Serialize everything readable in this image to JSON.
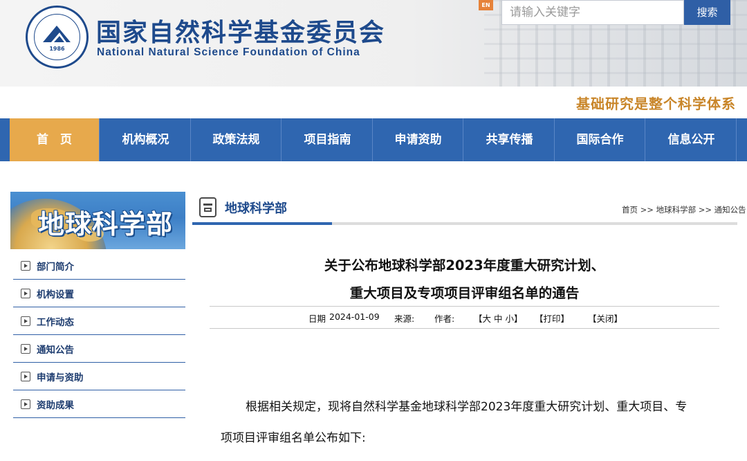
{
  "header": {
    "site_title_cn": "国家自然科学基金委员会",
    "site_title_en": "National Natural Science Foundation of China",
    "logo_year": "1986",
    "lang_switch": "EN",
    "search": {
      "placeholder": "请输入关键字",
      "button_label": "搜索"
    }
  },
  "slogan": "基础研究是整个科学体系",
  "nav": {
    "items": [
      {
        "label": "首　页",
        "active": true
      },
      {
        "label": "机构概况"
      },
      {
        "label": "政策法规"
      },
      {
        "label": "项目指南"
      },
      {
        "label": "申请资助"
      },
      {
        "label": "共享传播"
      },
      {
        "label": "国际合作"
      },
      {
        "label": "信息公开"
      }
    ]
  },
  "sidebar": {
    "banner_title": "地球科学部",
    "items": [
      {
        "label": "部门简介"
      },
      {
        "label": "机构设置"
      },
      {
        "label": "工作动态"
      },
      {
        "label": "通知公告"
      },
      {
        "label": "申请与资助"
      },
      {
        "label": "资助成果"
      }
    ]
  },
  "main": {
    "section_title": "地球科学部",
    "breadcrumb": "首页 >> 地球科学部 >> 通知公告",
    "article": {
      "title_line1": "关于公布地球科学部2023年度重大研究计划、",
      "title_line2": "重大项目及专项项目评审组名单的通告",
      "meta": {
        "date_label": "日期",
        "date": "2024-01-09",
        "source_label": "来源:",
        "author_label": "作者:",
        "font_size_control": "【大 中 小】",
        "print_label": "【打印】",
        "close_label": "【关闭】"
      },
      "body_line1": "根据相关规定，现将自然科学基金地球科学部2023年度重大研究计划、重大项目、专",
      "body_line2": "项项目评审组名单公布如下:"
    }
  },
  "colors": {
    "brand_blue": "#1e4a8c",
    "nav_blue": "#2f66b0",
    "nav_active": "#e7a94c",
    "slogan_gold": "#c9862a"
  }
}
